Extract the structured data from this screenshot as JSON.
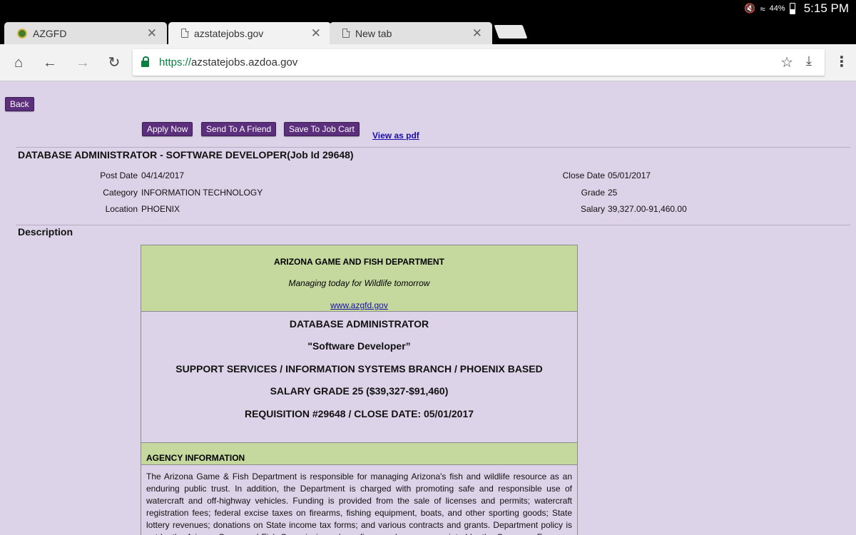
{
  "status_bar": {
    "battery": "44%",
    "time": "5:15 PM"
  },
  "tabs": [
    {
      "title": "AZGFD",
      "icon": "azgfd-favicon"
    },
    {
      "title": "azstatejobs.gov",
      "icon": "page-icon",
      "active": true
    },
    {
      "title": "New tab",
      "icon": "page-icon"
    }
  ],
  "toolbar": {
    "url_scheme": "https://",
    "url_host": "azstatejobs.azdoa.gov"
  },
  "page": {
    "back_label": "Back",
    "apply_label": "Apply Now",
    "send_label": "Send To A Friend",
    "save_label": "Save To Job Cart",
    "pdf_label": "View as pdf",
    "job_title": "DATABASE ADMINISTRATOR - SOFTWARE DEVELOPER(Job Id 29648)",
    "meta": {
      "post_date_label": "Post Date",
      "post_date": "04/14/2017",
      "category_label": "Category",
      "category": "INFORMATION TECHNOLOGY",
      "location_label": "Location",
      "location": "PHOENIX",
      "close_date_label": "Close Date",
      "close_date": "05/01/2017",
      "grade_label": "Grade",
      "grade": "25",
      "salary_label": "Salary",
      "salary": "39,327.00-91,460.00"
    },
    "description_heading": "Description",
    "description": {
      "agency_name": "ARIZONA GAME AND FISH DEPARTMENT",
      "motto": "Managing today for Wildlife tomorrow",
      "website": "www.azgfd.gov",
      "position_lines": [
        "DATABASE ADMINISTRATOR",
        "\"Software Developer”",
        "SUPPORT SERVICES / INFORMATION SYSTEMS BRANCH / PHOENIX BASED",
        "SALARY GRADE 25 ($39,327-$91,460)",
        "REQUISITION #29648 / CLOSE DATE: 05/01/2017"
      ],
      "agency_info_heading": "AGENCY INFORMATION",
      "agency_info_text": "The Arizona Game & Fish Department is responsible for managing Arizona's fish and wildlife resource as an enduring public trust. In addition, the Department is charged with promoting safe and responsible use of watercraft and off-highway vehicles. Funding is provided from the sale of licenses and permits; watercraft registration fees; federal excise taxes on firearms, fishing equipment, boats, and other sporting goods; State lottery revenues; donations on State income tax forms; and various contracts and grants. Department policy is set by the Arizona Game and Fish Commission, whose five members are appointed by the Governor. For more information, please"
    }
  }
}
